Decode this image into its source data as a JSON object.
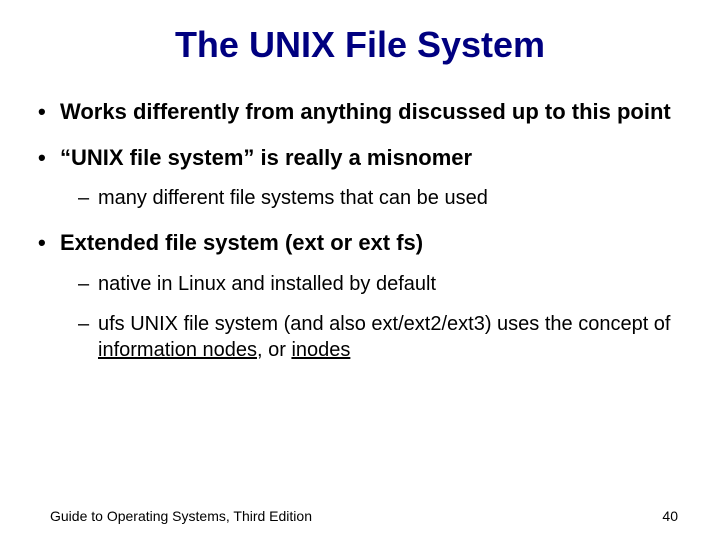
{
  "title": "The UNIX File System",
  "bullets": {
    "b1": "Works differently from anything discussed up to this point",
    "b2": "“UNIX file system” is really a misnomer",
    "b2_sub1": "many different file systems that can be used",
    "b3": "Extended file system (ext or ext fs)",
    "b3_sub1": "native in Linux and installed by default",
    "b3_sub2_pre": "ufs UNIX file system (and also ext/ext2/ext3) uses the concept of ",
    "b3_sub2_u": "information nodes",
    "b3_sub2_mid": ", or ",
    "b3_sub2_u2": "inodes"
  },
  "footer": {
    "left": "Guide to Operating Systems, Third Edition",
    "right": "40"
  }
}
